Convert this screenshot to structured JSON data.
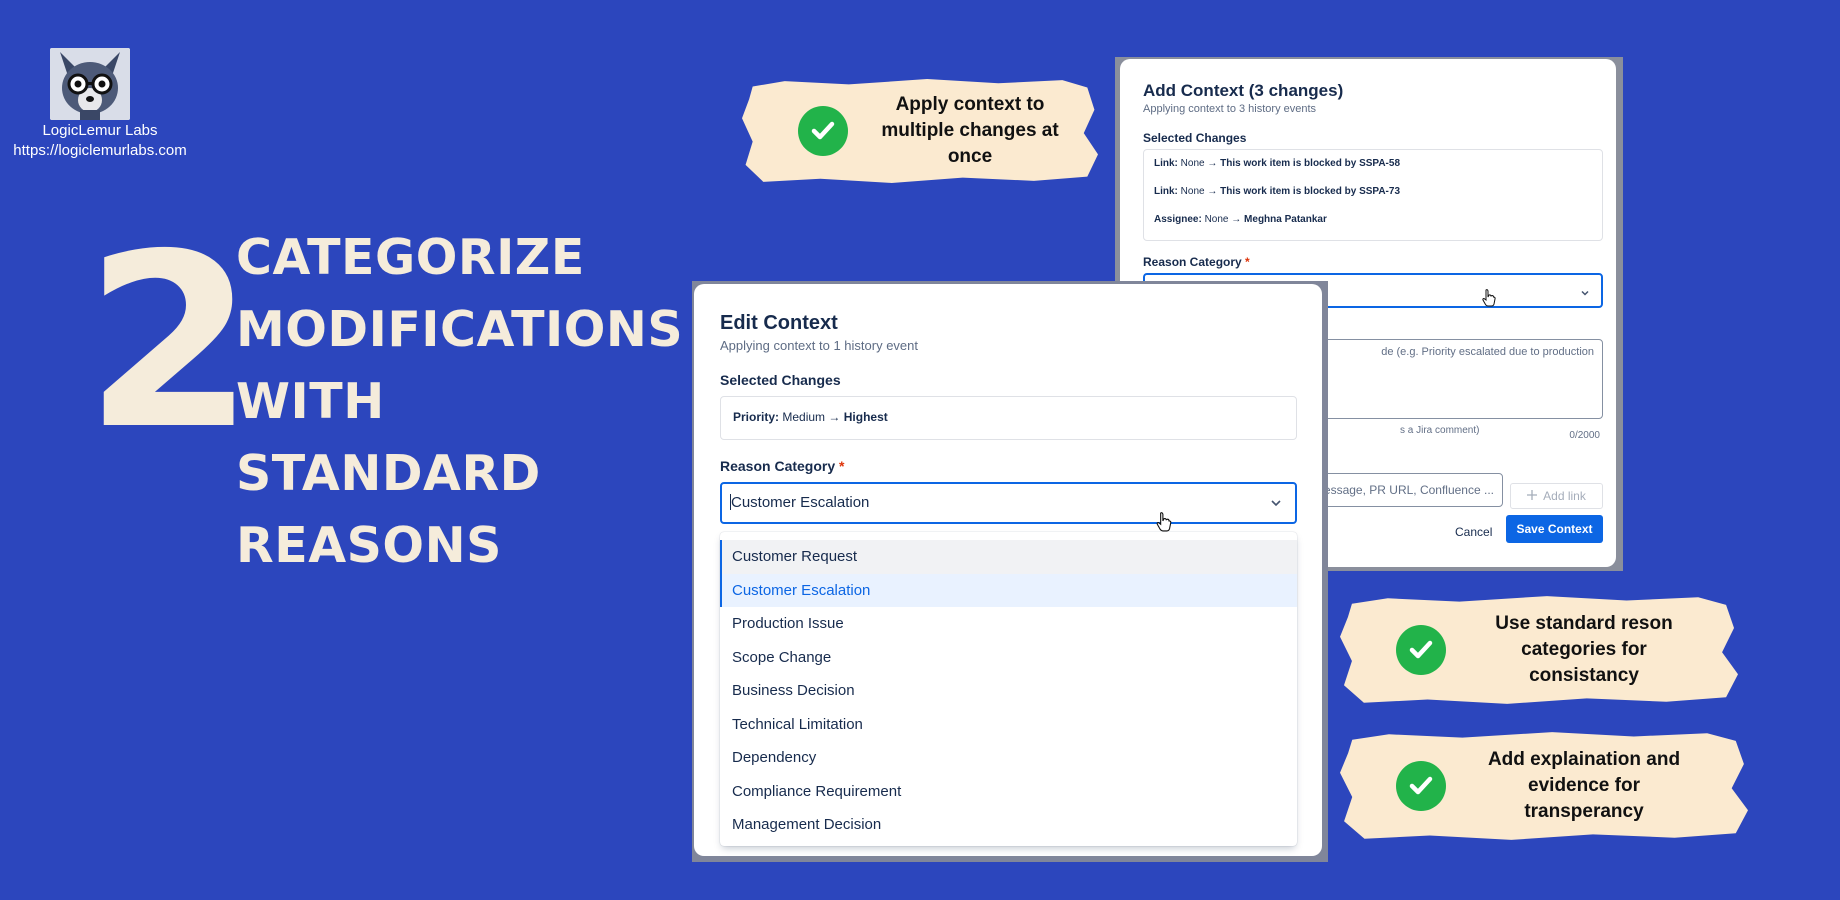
{
  "brand": {
    "name": "LogicLemur Labs",
    "url": "https://logiclemurlabs.com"
  },
  "headline": {
    "number": "2",
    "lines": [
      "CATEGORIZE",
      "MODIFICATIONS",
      "WITH",
      "STANDARD",
      "REASONS"
    ]
  },
  "callouts": [
    {
      "text": "Apply context to multiple changes at once"
    },
    {
      "text": "Use standard reson categories for consistancy"
    },
    {
      "text": "Add explaination and evidence for transperancy"
    }
  ],
  "add_context_dialog": {
    "title": "Add Context (3 changes)",
    "subtitle": "Applying context to 3 history events",
    "selected_changes_label": "Selected Changes",
    "changes": [
      {
        "field": "Link:",
        "from": "None",
        "to": "This work item is blocked by SSPA-58"
      },
      {
        "field": "Link:",
        "from": "None",
        "to": "This work item is blocked by SSPA-73"
      },
      {
        "field": "Assignee:",
        "from": "None",
        "to": "Meghna Patankar"
      }
    ],
    "arrow": "→",
    "reason_category_label": "Reason Category",
    "required_mark": "*",
    "explanation_placeholder": "de (e.g. Priority escalated due to production",
    "helper_text": "s a Jira comment)",
    "char_count": "0/2000",
    "evidence_placeholder": "essage, PR URL, Confluence ...",
    "add_link_label": "Add link",
    "cancel_label": "Cancel",
    "save_label": "Save Context"
  },
  "edit_context_dialog": {
    "title": "Edit Context",
    "subtitle": "Applying context to 1 history event",
    "selected_changes_label": "Selected Changes",
    "change": {
      "field": "Priority:",
      "from": "Medium",
      "arrow": "→",
      "to": "Highest"
    },
    "reason_category_label": "Reason Category",
    "required_mark": "*",
    "selected_value": "Customer Escalation",
    "options": [
      "Customer Request",
      "Customer Escalation",
      "Production Issue",
      "Scope Change",
      "Business Decision",
      "Technical Limitation",
      "Dependency",
      "Compliance Requirement",
      "Management Decision"
    ]
  },
  "colors": {
    "background": "#2c46bd",
    "headline": "#f5ecdb",
    "callout": "#fbead0",
    "check": "#22b34a",
    "primary": "#0c66e4"
  },
  "icons": [
    "check-icon",
    "chevron-down-icon",
    "plus-icon",
    "hand-cursor-icon"
  ]
}
